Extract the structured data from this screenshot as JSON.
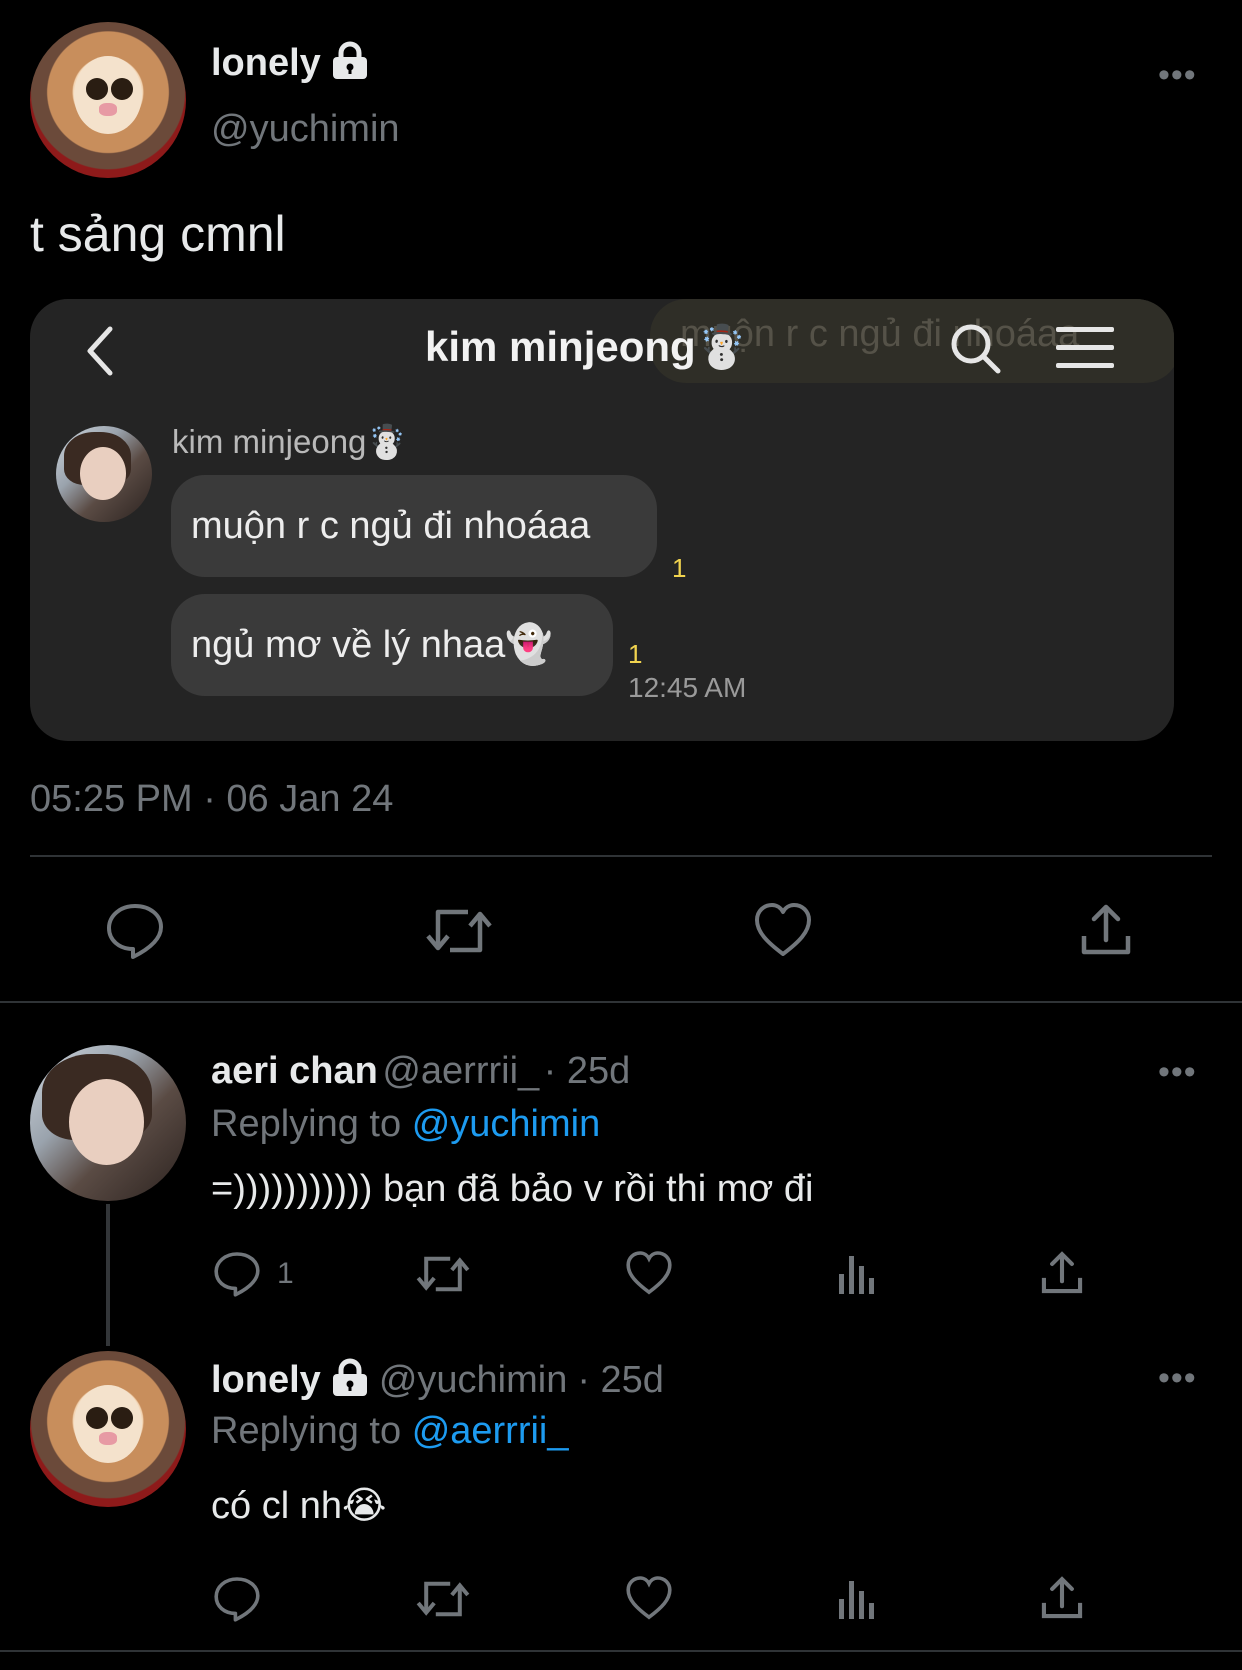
{
  "tweet": {
    "author_name": "lonely",
    "author_handle": "@yuchimin",
    "more": "•••",
    "text": "t sảng cmnl",
    "timestamp": "05:25 PM · 06 Jan 24",
    "locked_icon": "lock-icon",
    "actions": [
      "reply-icon",
      "retweet-icon",
      "like-icon",
      "share-icon"
    ]
  },
  "embedded": {
    "back_icon": "back-chevron-icon",
    "title": "kim minjeong☃️",
    "overlay_text": "muộn r c ngủ đi nhoáaa",
    "search_icon": "search-icon",
    "menu_icon": "menu-icon",
    "sender_name": "kim minjeong☃️",
    "messages": [
      {
        "text": "muộn r c ngủ đi nhoáaa",
        "unread": "1"
      },
      {
        "text": "ngủ mơ về lý nhaa👻",
        "unread": "1"
      }
    ],
    "time": "12:45 AM"
  },
  "replies": [
    {
      "name": "aeri chan",
      "handle": "@aerrrii_",
      "age": "· 25d",
      "replying_label": "Replying to",
      "replying_to": "@yuchimin",
      "text": "=))))))))))) bạn đã bảo v rồi thi mơ đi",
      "reply_count": "1",
      "more": "•••"
    },
    {
      "name": "lonely",
      "handle": "@yuchimin",
      "age": "· 25d",
      "replying_label": "Replying to",
      "replying_to": "@aerrrii_",
      "text": "có cl nh😭",
      "more": "•••"
    }
  ],
  "colors": {
    "background": "#000000",
    "text": "#e7e9ea",
    "muted": "#71767b",
    "link": "#1d9bf0",
    "unread": "#f1d34f"
  }
}
